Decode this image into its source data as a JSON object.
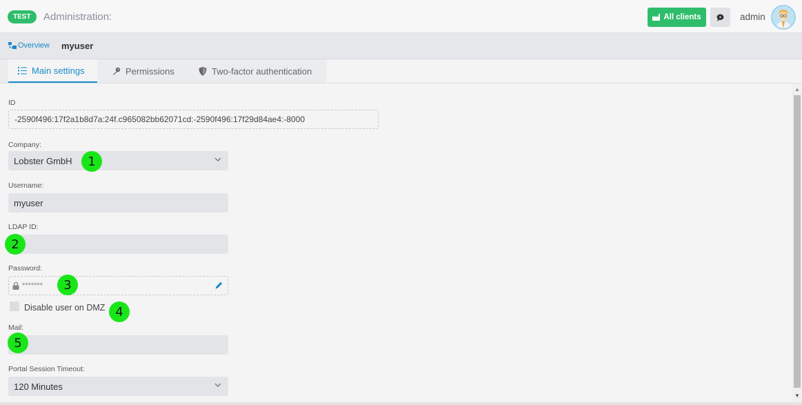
{
  "header": {
    "env_badge": "TEST",
    "title": "Administration:",
    "all_clients_label": "All clients",
    "user_name": "admin"
  },
  "breadcrumb": {
    "overview_label": "Overview",
    "current": "myuser"
  },
  "tabs": [
    {
      "label": "Main settings",
      "icon": "list-icon",
      "active": true
    },
    {
      "label": "Permissions",
      "icon": "key-icon",
      "active": false
    },
    {
      "label": "Two-factor authentication",
      "icon": "shield-icon",
      "active": false
    }
  ],
  "form": {
    "id": {
      "label": "ID",
      "value": "-2590f496:17f2a1b8d7a:24f.c965082bb62071cd:-2590f496:17f29d84ae4:-8000"
    },
    "company": {
      "label": "Company:",
      "value": "Lobster GmbH"
    },
    "username": {
      "label": "Username:",
      "value": "myuser"
    },
    "ldap_id": {
      "label": "LDAP ID:",
      "value": ""
    },
    "password": {
      "label": "Password:",
      "value": "*******"
    },
    "disable_dmz": {
      "label": "Disable user on DMZ",
      "checked": false
    },
    "mail": {
      "label": "Mail:",
      "value": ""
    },
    "portal_timeout": {
      "label": "Portal Session Timeout:",
      "value": "120 Minutes"
    }
  },
  "markers": [
    "1",
    "2",
    "3",
    "4",
    "5"
  ],
  "colors": {
    "accent_green": "#2ebd6a",
    "link_blue": "#1a8ac6",
    "marker_green": "#19e619"
  }
}
